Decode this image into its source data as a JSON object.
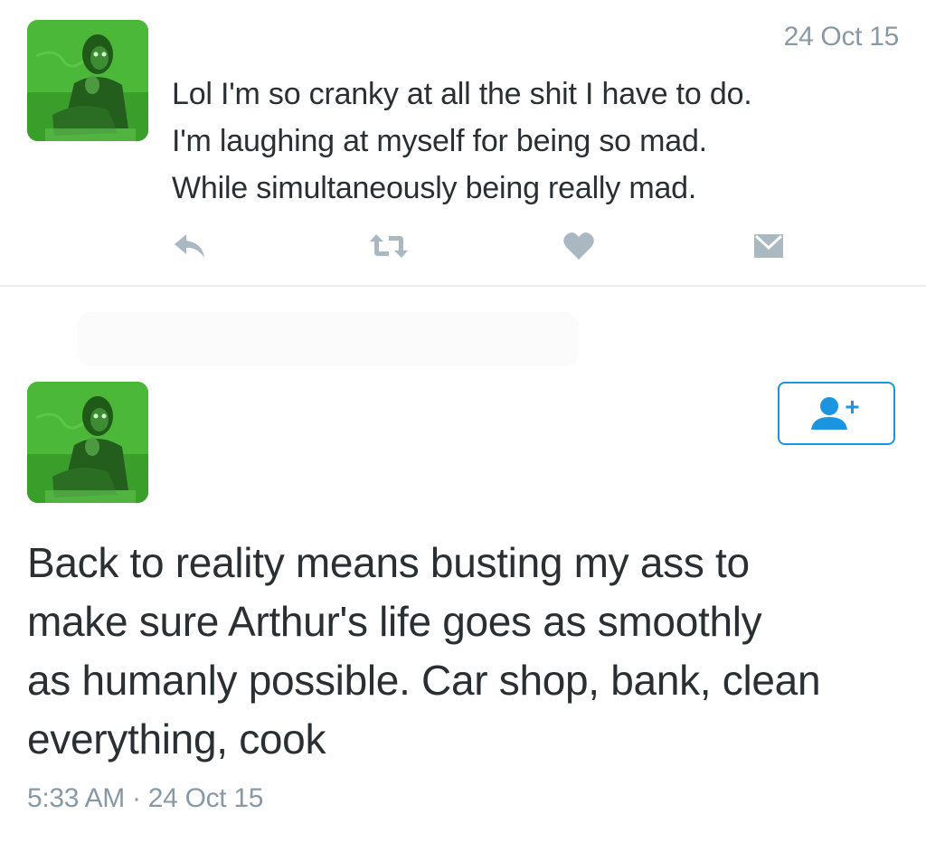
{
  "tweet1": {
    "timestamp": "24 Oct 15",
    "text_lines": [
      "Lol I'm so cranky at all the shit I have to do.",
      "I'm laughing at myself for being so mad.",
      "While simultaneously being really mad."
    ],
    "actions": [
      {
        "name": "reply",
        "icon": "reply-icon"
      },
      {
        "name": "retweet",
        "icon": "retweet-icon"
      },
      {
        "name": "like",
        "icon": "heart-icon"
      },
      {
        "name": "direct-message",
        "icon": "envelope-icon"
      }
    ]
  },
  "tweet2": {
    "follow_icon": "follow-user-plus-icon",
    "text_lines": [
      "Back to reality means busting my ass to",
      "make sure Arthur's life goes as smoothly",
      "as humanly possible. Car shop, bank, clean",
      "everything, cook"
    ],
    "time": "5:33 AM",
    "separator": "·",
    "date": "24 Oct 15"
  },
  "colors": {
    "text": "#292f33",
    "muted": "#8899a6",
    "action_icon": "#aab8c2",
    "accent": "#1b95e0",
    "divider": "#e6ecf0",
    "avatar_tint": "#3faa2c"
  }
}
